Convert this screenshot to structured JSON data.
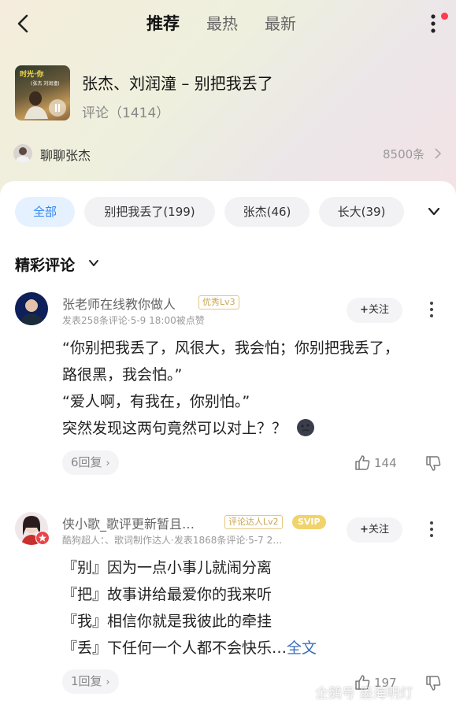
{
  "nav": {
    "tabs": [
      "推荐",
      "最热",
      "最新"
    ],
    "active_tab": 0
  },
  "song": {
    "cover_title": "时光·你",
    "cover_sub": "(张杰 刘润潼)",
    "title": "张杰、刘润潼 – 别把我丢了",
    "comment_count": "评论（1414）"
  },
  "chat": {
    "label": "聊聊张杰",
    "count": "8500条"
  },
  "chips": [
    "全部",
    "别把我丢了(199)",
    "张杰(46)",
    "长大(39)"
  ],
  "section_title": "精彩评论",
  "comments": [
    {
      "username": "张老师在线教你做人",
      "level": "优秀Lv3",
      "meta": "发表258条评论·5-9 18:00被点赞",
      "follow": "关注",
      "lines": [
        "“你别把我丢了，风很大，我会怕；你别把我丢了，",
        "路很黑，我会怕。”",
        "“爱人啊，有我在，你别怕。”",
        "突然发现这两句竟然可以对上？？"
      ],
      "replies": "6回复",
      "likes": "144"
    },
    {
      "username": "侠小歌_歌评更新暂且…",
      "level": "评论达人Lv2",
      "svip": "SVIP",
      "meta": "酷狗超人：、歌词制作达人·发表1868条评论·5-7 2…",
      "follow": "关注",
      "lines": [
        "『别』因为一点小事儿就闹分离",
        "『把』故事讲给最爱你的我来听",
        "『我』相信你就是我彼此的牵挂",
        "『丢』下任何一个人都不会快乐…"
      ],
      "full_text": "全文",
      "replies": "1回复",
      "likes": "197"
    }
  ],
  "watermark": "企鹅号 墨海明灯",
  "colors": {
    "accent_blue": "#2f86f6",
    "badge_red": "#ff3b4f",
    "svip_gold": "#f1d36b"
  }
}
